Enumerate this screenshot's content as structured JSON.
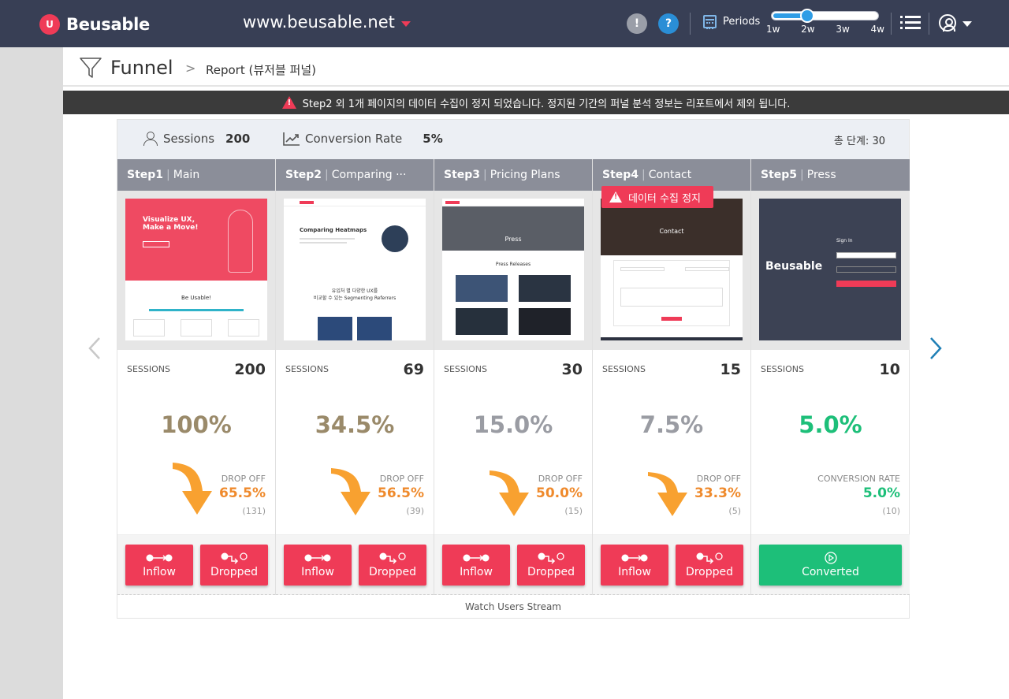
{
  "app": {
    "name": "Beusable",
    "site": "www.beusable.net"
  },
  "header": {
    "notice_icon": "!",
    "help_icon": "?",
    "periods_label": "Periods",
    "period_ticks": [
      "1w",
      "2w",
      "3w",
      "4w"
    ],
    "period_value": "2w",
    "period_fraction": 0.33
  },
  "page": {
    "title": "Funnel",
    "breadcrumb": "Report (뷰저블 퍼널)"
  },
  "banner": {
    "text": "Step2 외 1개 페이지의 데이터 수집이 정지 되었습니다. 정지된 기간의 퍼널 분석 정보는 리포트에서 제외 됩니다."
  },
  "summary": {
    "sessions_label": "Sessions",
    "sessions_value": "200",
    "conversion_label": "Conversion Rate",
    "conversion_value": "5%",
    "total_steps": "총 단계: 30"
  },
  "stop_badge": "데이터 수집 정지",
  "sessions_label": "SESSIONS",
  "drop_label": "DROP OFF",
  "conversion_label": "CONVERSION RATE",
  "buttons": {
    "inflow": "Inflow",
    "dropped": "Dropped",
    "converted": "Converted"
  },
  "watch_stream": "Watch Users Stream",
  "colors": {
    "accent": "#ef3b57",
    "success": "#1dbf79",
    "drop": "#ef8a2c",
    "funnel": "#fdd36b"
  },
  "steps": [
    {
      "num": "Step1",
      "name": "Main",
      "sessions": "200",
      "pct": "100%",
      "drop_pct": "65.5%",
      "drop_count": "(131)",
      "thumb": {
        "line1": "Visualize UX,",
        "line2": "Make a Move!",
        "line3": "Be Usable!"
      }
    },
    {
      "num": "Step2",
      "name": "Comparing ···",
      "sessions": "69",
      "pct": "34.5%",
      "drop_pct": "56.5%",
      "drop_count": "(39)",
      "thumb": {
        "line1": "Comparing Heatmaps",
        "line2": "유입처 별 다양한 UX를",
        "line3": "비교할 수 있는 Segmenting Referrers"
      }
    },
    {
      "num": "Step3",
      "name": "Pricing Plans",
      "sessions": "30",
      "pct": "15.0%",
      "drop_pct": "50.0%",
      "drop_count": "(15)",
      "thumb": {
        "line1": "Press",
        "line2": "Press Releases",
        "line3": ""
      }
    },
    {
      "num": "Step4",
      "name": "Contact",
      "sessions": "15",
      "pct": "7.5%",
      "drop_pct": "33.3%",
      "drop_count": "(5)",
      "thumb": {
        "line1": "Contact",
        "line2": "",
        "line3": ""
      }
    },
    {
      "num": "Step5",
      "name": "Press",
      "sessions": "10",
      "pct": "5.0%",
      "conv_pct": "5.0%",
      "conv_count": "(10)",
      "thumb": {
        "line1": "Beusable",
        "line2": "Sign In",
        "line3": ""
      }
    }
  ]
}
